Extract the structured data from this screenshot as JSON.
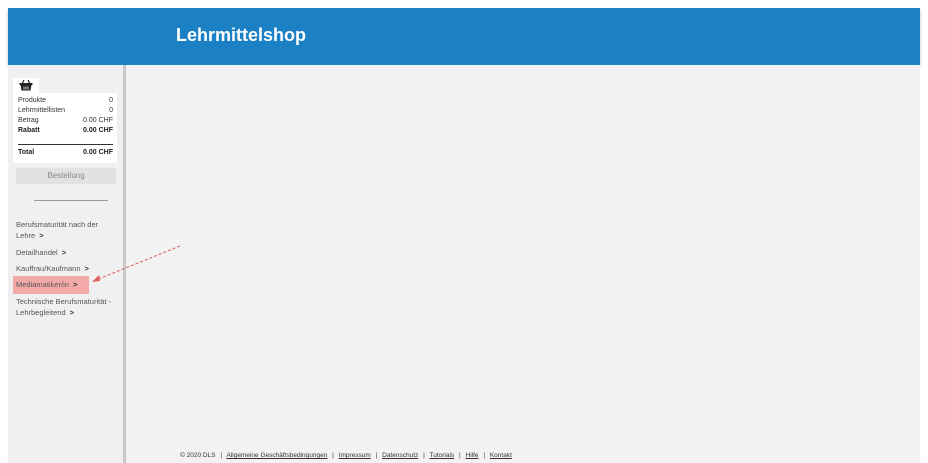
{
  "header": {
    "title": "Lehrmittelshop"
  },
  "cart": {
    "icon": "shopping-basket-icon",
    "rows": [
      {
        "label": "Produkte",
        "value": "0"
      },
      {
        "label": "Lehrmittellisten",
        "value": "0"
      },
      {
        "label": "Betrag",
        "value": "0.00 CHF"
      },
      {
        "label": "Rabatt",
        "value": "0.00 CHF"
      },
      {
        "label": "Total",
        "value": "0.00 CHF"
      }
    ],
    "order_button": "Bestellung"
  },
  "categories": [
    {
      "label_line1": "Berufsmaturität nach der",
      "label_line2": "Lehre"
    },
    {
      "label": "Detailhandel"
    },
    {
      "label": "Kauffrau/Kaufmann"
    },
    {
      "label": "Mediamatiker/in",
      "highlighted": true
    },
    {
      "label_line1": "Technische Berufsmaturität -",
      "label_line2": "Lehrbegleitend"
    }
  ],
  "chevron": ">",
  "footer": {
    "copyright": "© 2020 DLS",
    "links": [
      "Allgemeine Geschäftsbedingungen",
      "Impressum",
      "Datenschutz",
      "Tutorials",
      "Hilfe",
      "Kontakt"
    ],
    "separator": "|"
  },
  "colors": {
    "header": "#1b80c4",
    "highlight": "#f4a9a9",
    "arrow": "#e06060"
  }
}
